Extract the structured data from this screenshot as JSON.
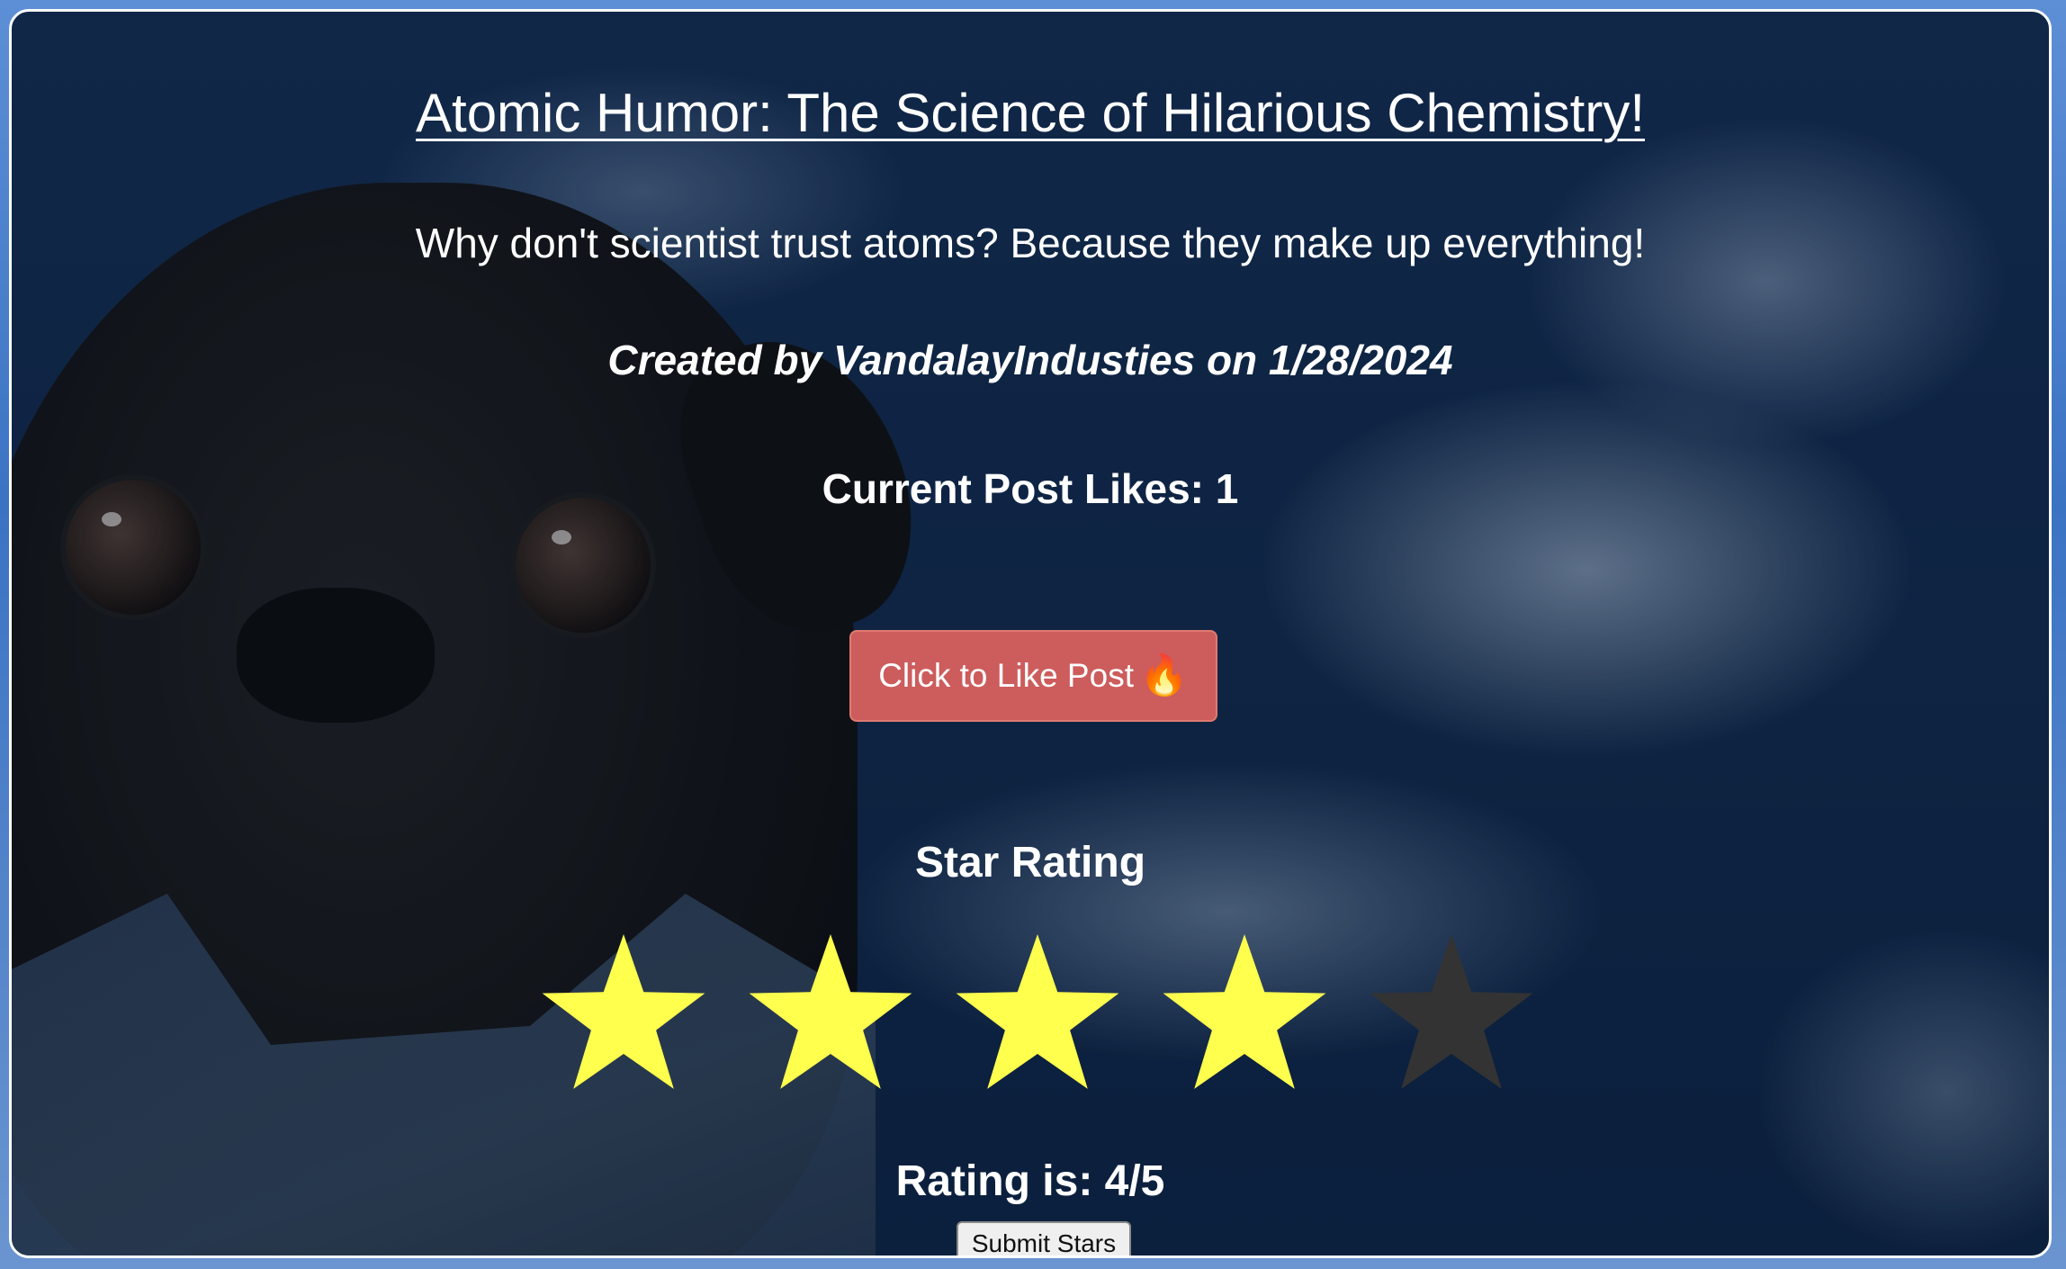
{
  "post": {
    "title": "Atomic Humor: The Science of Hilarious Chemistry!",
    "joke": "Why don't scientist trust atoms? Because they make up everything!",
    "author_line": "Created by VandalayIndusties on 1/28/2024",
    "likes_line": "Current Post Likes: 1"
  },
  "like_button": {
    "label": "Click to Like Post",
    "icon": "fire-icon",
    "emoji": "🔥",
    "color": "#cd5c5c"
  },
  "rating": {
    "heading": "Star Rating",
    "value": 4,
    "max": 5,
    "filled_color": "#ffff4d",
    "empty_color": "#333333",
    "result_text": "Rating is: 4/5",
    "submit_label": "Submit Stars"
  }
}
